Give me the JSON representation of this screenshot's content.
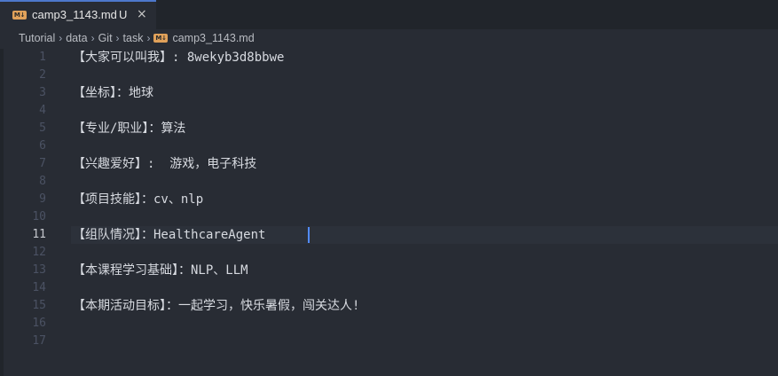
{
  "tab": {
    "title": "camp3_1143.md",
    "status": "U",
    "icon_label": "M↓",
    "close_glyph": "×"
  },
  "breadcrumb": {
    "items": [
      "Tutorial",
      "data",
      "Git",
      "task"
    ],
    "file": "camp3_1143.md",
    "separator": "›"
  },
  "editor": {
    "active_line": 11,
    "line_numbers": [
      "1",
      "2",
      "3",
      "4",
      "5",
      "6",
      "7",
      "8",
      "9",
      "10",
      "11",
      "12",
      "13",
      "14",
      "15",
      "16",
      "17"
    ],
    "lines": [
      "【大家可以叫我】: 8wekyb3d8bbwe",
      "",
      "【坐标】：地球",
      "",
      "【专业/职业】：算法",
      "",
      "【兴趣爱好】:  游戏，电子科技",
      "",
      "【项目技能】：cv、nlp",
      "",
      "【组队情况】：HealthcareAgent",
      "",
      "【本课程学习基础】：NLP、LLM",
      "",
      "【本期活动目标】：一起学习，快乐暑假，闯关达人!",
      "",
      ""
    ]
  },
  "colors": {
    "background": "#282c34",
    "tab_accent": "#4d78cc",
    "md_icon": "#e0a15a",
    "cursor": "#528bff"
  }
}
